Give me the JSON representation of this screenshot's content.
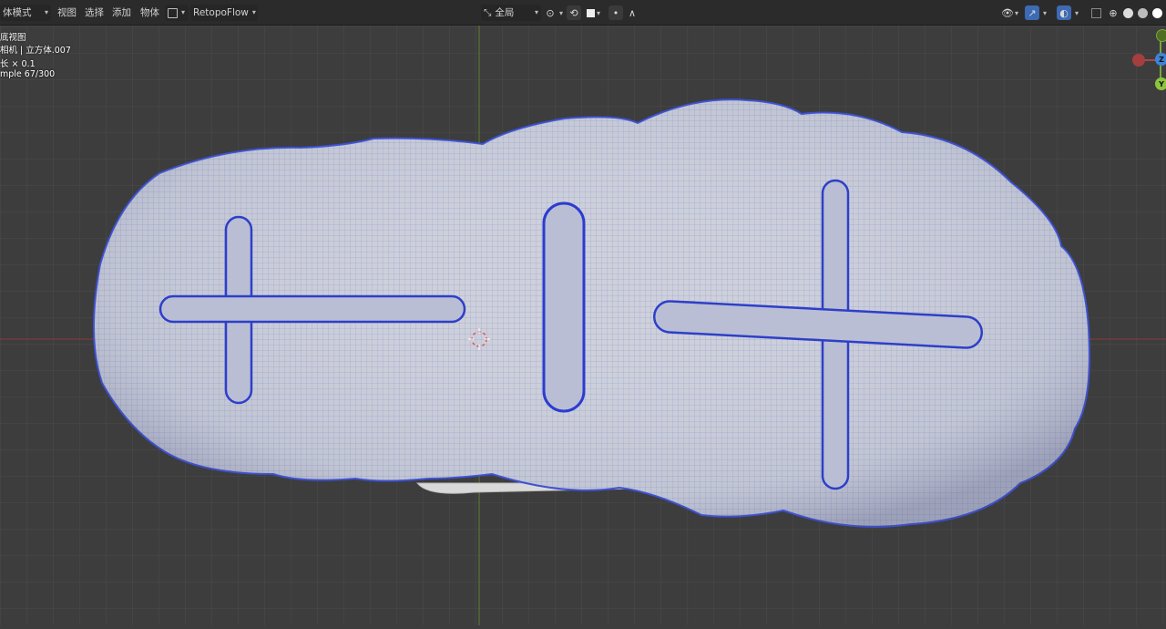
{
  "header": {
    "mode_label": "体模式",
    "menu": [
      "视图",
      "选择",
      "添加",
      "物体"
    ],
    "addon_label": "RetopoFlow",
    "transform_orientation": "全局"
  },
  "overlay_info": {
    "view_name": "底视图",
    "object_name": "相机 | 立方体.007",
    "scale_text": "长 × 0.1",
    "sample_text": "mple 67/300"
  },
  "gizmo": {
    "z_label": "Z",
    "y_label": "Y"
  },
  "colors": {
    "mesh_wire": "#3a4fd6",
    "mesh_fill": "#c9ccd6",
    "grid_bg": "#3d3d3d",
    "x_axis": "#b04545",
    "y_axis": "#7aa63a",
    "z_axis": "#3d84d8"
  },
  "icons": [
    "transform-orientation-icon",
    "snap-icon",
    "proportional-edit-icon",
    "visibility-icon",
    "gizmo-icon",
    "overlay-icon",
    "xray-icon",
    "shading-wireframe-icon",
    "shading-solid-icon",
    "shading-material-icon",
    "shading-rendered-icon"
  ]
}
